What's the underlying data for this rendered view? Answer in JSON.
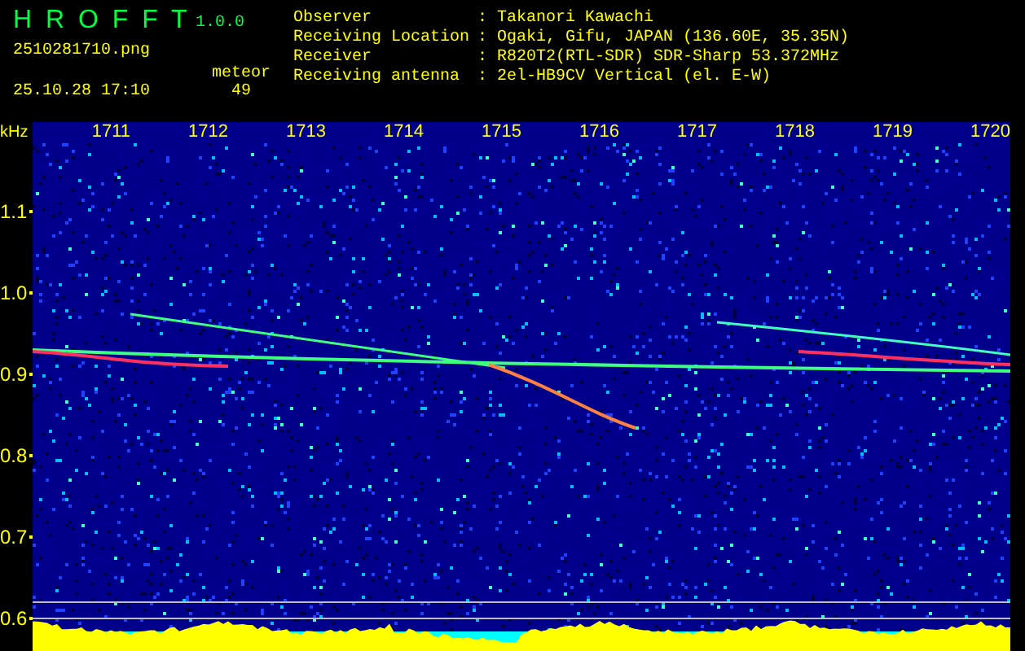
{
  "app": {
    "title": "H R O F F T",
    "version": "1.0.0"
  },
  "capture": {
    "file": "2510281710.png",
    "datetime": "25.10.28 17:10",
    "count_label": "meteor",
    "count": "49"
  },
  "info": [
    {
      "label": "Observer",
      "value": ": Takanori Kawachi"
    },
    {
      "label": "Receiving Location",
      "value": ": Ogaki, Gifu, JAPAN (136.60E, 35.35N)"
    },
    {
      "label": "Receiver",
      "value": ": R820T2(RTL-SDR) SDR-Sharp 53.372MHz"
    },
    {
      "label": "Receiving antenna",
      "value": ": 2el-HB9CV Vertical (el. E-W)"
    }
  ],
  "spectrogram": {
    "unit": "kHz",
    "x_ticks": [
      "1711",
      "1712",
      "1713",
      "1714",
      "1715",
      "1716",
      "1717",
      "1718",
      "1719",
      "1720"
    ],
    "y_ticks": [
      "1.1",
      "1.0",
      "0.9",
      "0.8",
      "0.7",
      "0.6"
    ]
  }
}
